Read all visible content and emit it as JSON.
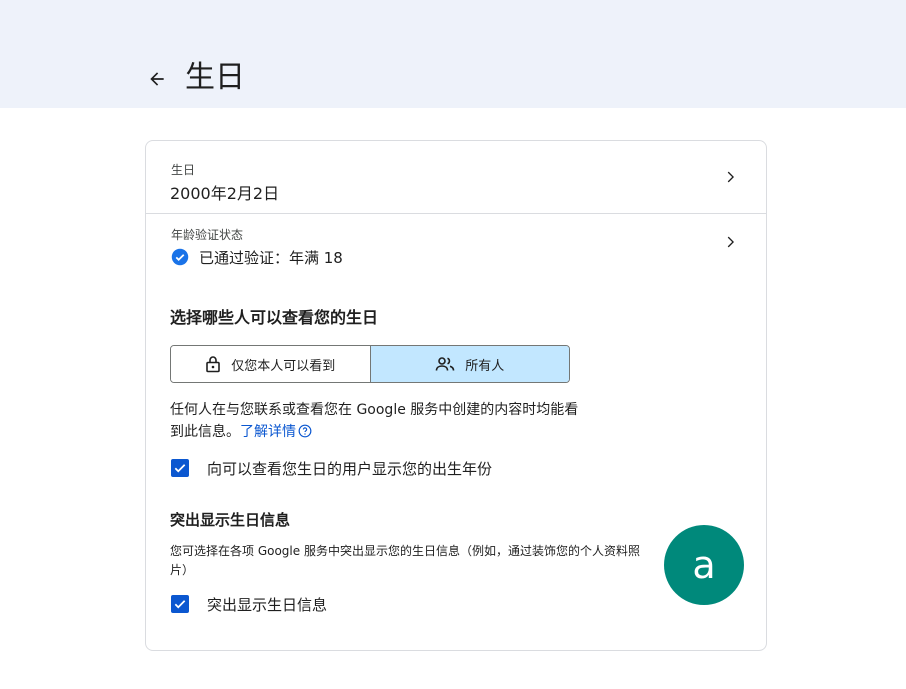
{
  "header": {
    "title": "生日"
  },
  "birthday_row": {
    "label": "生日",
    "value": "2000年2月2日"
  },
  "age_row": {
    "label": "年龄验证状态",
    "value": "已通过验证：年满 18"
  },
  "visibility": {
    "heading": "选择哪些人可以查看您的生日",
    "options": [
      {
        "label": "仅您本人可以看到",
        "icon": "lock-icon",
        "selected": false
      },
      {
        "label": "所有人",
        "icon": "people-icon",
        "selected": true
      }
    ],
    "description": "任何人在与您联系或查看您在 Google 服务中创建的内容时均能看到此信息。",
    "learn_more": "了解详情"
  },
  "show_year_checkbox": {
    "label": "向可以查看您生日的用户显示您的出生年份",
    "checked": true
  },
  "highlight": {
    "heading": "突出显示生日信息",
    "description": "您可选择在各项 Google 服务中突出显示您的生日信息（例如，通过装饰您的个人资料照片）",
    "checkbox_label": "突出显示生日信息",
    "checked": true
  },
  "avatar": {
    "letter": "a",
    "color": "#00897b"
  },
  "colors": {
    "accent": "#0b57d0",
    "selected_segment": "#c2e7ff",
    "header_band": "#eef2fa"
  }
}
